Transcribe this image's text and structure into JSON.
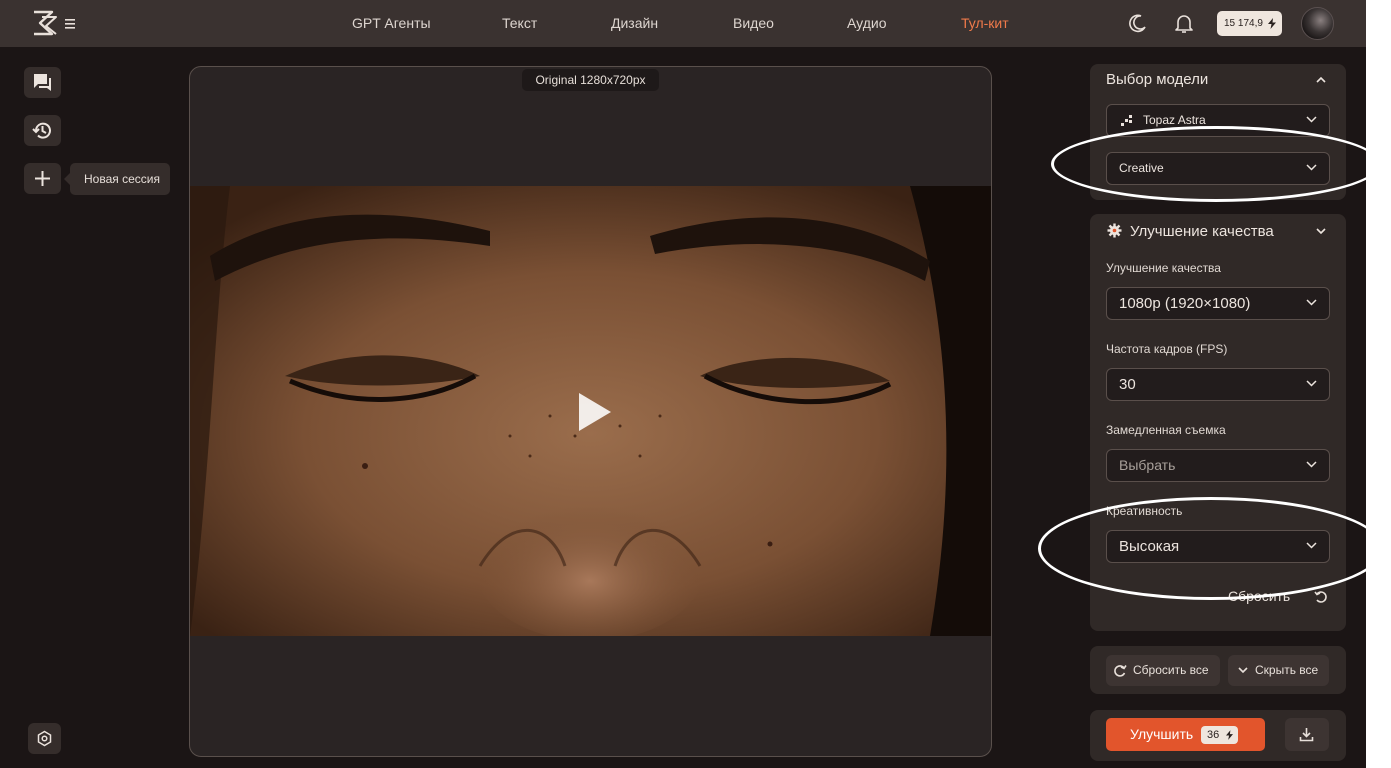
{
  "topbar": {
    "nav": [
      "GPT Агенты",
      "Текст",
      "Дизайн",
      "Видео",
      "Аудио",
      "Тул-кит"
    ],
    "active_nav": "Тул-кит",
    "balance": "15 174,9"
  },
  "sidebar": {
    "new_session_tooltip": "Новая сессия"
  },
  "preview": {
    "original_label": "Original 1280x720px"
  },
  "model_panel": {
    "title": "Выбор модели",
    "model": "Topaz Astra",
    "mode": "Creative"
  },
  "quality_panel": {
    "title": "Улучшение качества",
    "fields": [
      {
        "label": "Улучшение качества",
        "value": "1080p (1920×1080)"
      },
      {
        "label": "Частота кадров (FPS)",
        "value": "30"
      },
      {
        "label": "Замедленная съемка",
        "value": "Выбрать"
      },
      {
        "label": "Креативность",
        "value": "Высокая"
      }
    ],
    "reset_label": "Сбросить"
  },
  "actions": {
    "reset_all": "Сбросить все",
    "hide_all": "Скрыть все",
    "improve": "Улучшить",
    "improve_cost": "36"
  },
  "colors": {
    "accent": "#e2552c",
    "active_nav": "#f07a4a",
    "background": "#1b1515",
    "panel": "#302927",
    "annotation": "#ffffff"
  },
  "icons": [
    "menu-icon",
    "moon-icon",
    "bell-icon",
    "bolt-icon",
    "chat-icon",
    "history-icon",
    "plus-icon",
    "settings-icon",
    "play-icon",
    "chevron-down-icon",
    "chevron-up-icon",
    "gear-icon",
    "reset-icon",
    "download-icon",
    "model-icon"
  ]
}
